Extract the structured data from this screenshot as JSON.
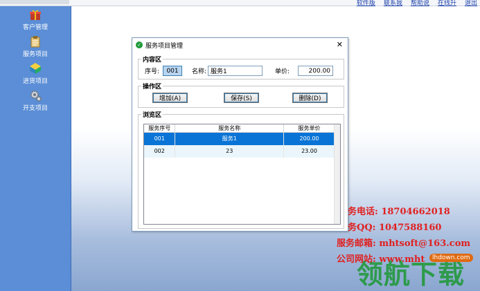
{
  "topbar": {
    "links": [
      "软件版",
      "联系我",
      "帮助说",
      "在线升",
      "退出"
    ]
  },
  "sidebar": {
    "items": [
      {
        "label": "客户管理",
        "icon": "gift-box-icon"
      },
      {
        "label": "服务项目",
        "icon": "clipboard-icon"
      },
      {
        "label": "进货项目",
        "icon": "package-icon"
      },
      {
        "label": "开支项目",
        "icon": "gear-icon"
      }
    ]
  },
  "dialog": {
    "title": "服务项目管理",
    "content_group": "内容区",
    "seq_label": "序号:",
    "seq_value": "001",
    "name_label": "名称:",
    "name_value": "服务1",
    "price_label": "单价:",
    "price_value": "200.00",
    "ops_group": "操作区",
    "add_label": "增加(A)",
    "save_label": "保存(S)",
    "delete_label": "删除(D)",
    "browse_group": "浏览区",
    "columns": [
      "服务序号",
      "服务名称",
      "服务单价"
    ],
    "rows": [
      {
        "seq": "001",
        "name": "服务1",
        "price": "200.00"
      },
      {
        "seq": "002",
        "name": "23",
        "price": "23.00"
      }
    ]
  },
  "contact": {
    "phone": "务电话: 18704662018",
    "qq": "务QQ: 1047588160",
    "email": "服务邮箱: mhtsoft@163.com",
    "site": "公司网站: www.mht"
  },
  "watermark": {
    "text": "领航下载",
    "badge": "lhdown.com"
  },
  "colors": {
    "sidebar": "#5b8ed6",
    "selection": "#0a74d6",
    "contact_text": "#e02020",
    "watermark": "#149628"
  }
}
